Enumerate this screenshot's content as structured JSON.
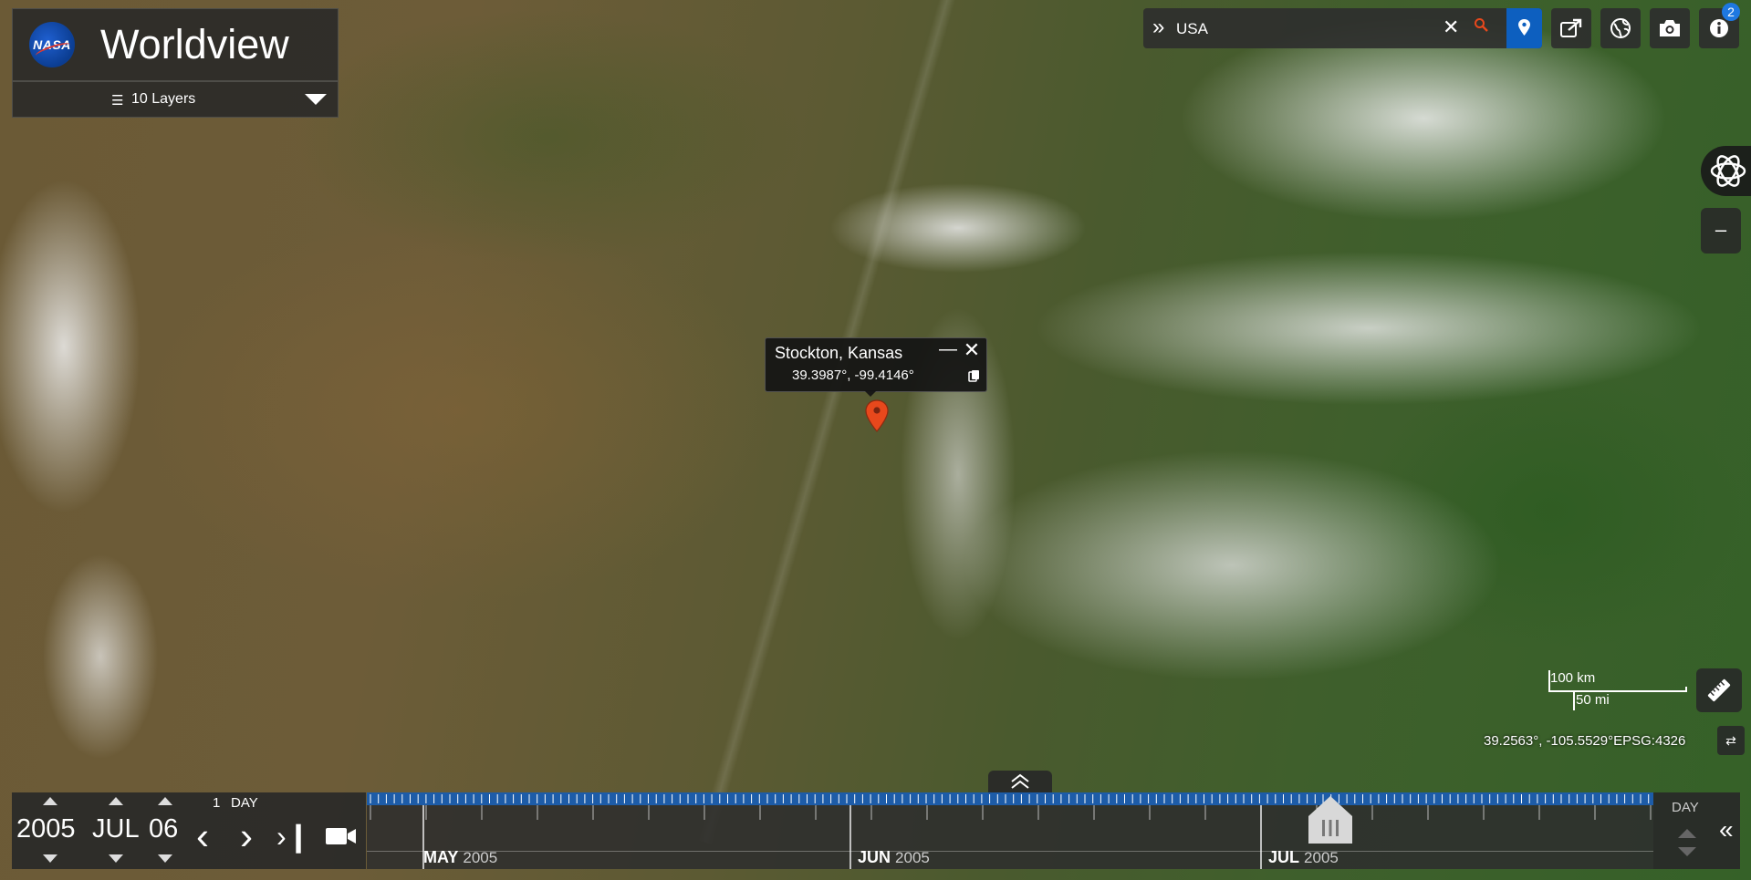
{
  "app": {
    "brand": "NASA",
    "title": "Worldview"
  },
  "layers": {
    "label": "10 Layers"
  },
  "search": {
    "value": "USA"
  },
  "toolbar": {
    "info_badge": "2"
  },
  "popup": {
    "place": "Stockton, Kansas",
    "coords": "39.3987°, -99.4146°"
  },
  "scale": {
    "metric": "100 km",
    "imperial": "50 mi"
  },
  "cursor": {
    "coords": "39.2563°, -105.5529°",
    "projection": "EPSG:4326"
  },
  "date": {
    "year": "2005",
    "month": "JUL",
    "day": "06",
    "interval": "1",
    "interval_unit": "DAY"
  },
  "timeline": {
    "months": [
      {
        "month": "MAY",
        "year": "2005"
      },
      {
        "month": "JUN",
        "year": "2005"
      },
      {
        "month": "JUL",
        "year": "2005"
      }
    ],
    "zoom_level": "DAY"
  },
  "colors": {
    "accent": "#1e78e0",
    "timeline_strip": "#1d5ca8",
    "marker": "#e8481c",
    "search_zoom": "#e8481c"
  },
  "icons": [
    "nasa-logo",
    "layers-icon",
    "caret-down-icon",
    "chevron-right-double-icon",
    "close-icon",
    "search-zoom-icon",
    "map-pin-icon",
    "share-icon",
    "globe-icon",
    "camera-icon",
    "info-icon",
    "rotate-3d-icon",
    "minus-icon",
    "ruler-icon",
    "swap-icon",
    "video-icon"
  ]
}
